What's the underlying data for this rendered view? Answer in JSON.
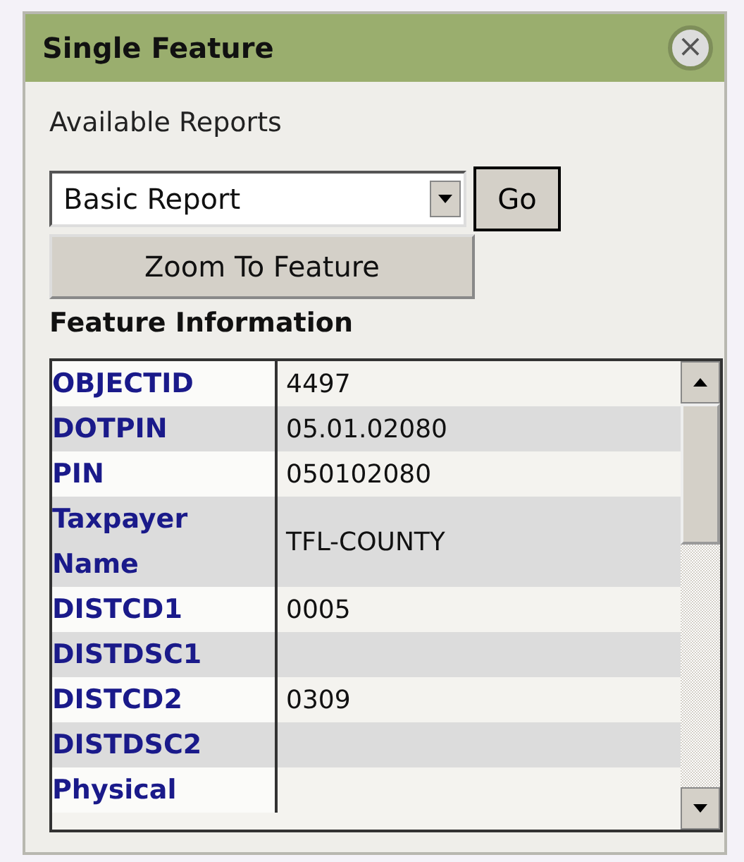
{
  "window": {
    "title": "Single Feature",
    "close": "×"
  },
  "reports": {
    "label": "Available Reports",
    "value": "Basic Report",
    "go": "Go"
  },
  "zoom_button": "Zoom To Feature",
  "section_title": "Feature Information",
  "rows": [
    {
      "label": "OBJECTID",
      "value": "4497"
    },
    {
      "label": "DOTPIN",
      "value": "05.01.02080"
    },
    {
      "label": "PIN",
      "value": "050102080"
    },
    {
      "label": "Taxpayer Name",
      "value": "TFL-COUNTY"
    },
    {
      "label": "DISTCD1",
      "value": "0005"
    },
    {
      "label": "DISTDSC1",
      "value": ""
    },
    {
      "label": "DISTCD2",
      "value": "0309"
    },
    {
      "label": "DISTDSC2",
      "value": ""
    },
    {
      "label": "Physical",
      "value": ""
    }
  ]
}
